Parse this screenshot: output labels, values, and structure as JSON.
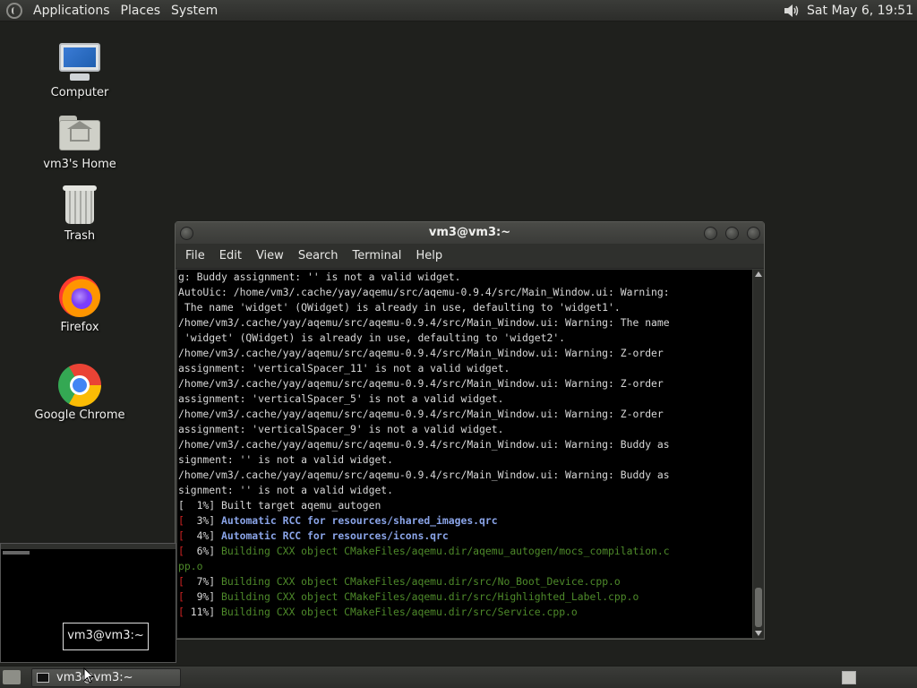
{
  "top_panel": {
    "menus": [
      "Applications",
      "Places",
      "System"
    ],
    "clock": "Sat May  6, 19:51"
  },
  "desktop_icons": [
    {
      "label": "Computer"
    },
    {
      "label": "vm3's Home"
    },
    {
      "label": "Trash"
    },
    {
      "label": "Firefox"
    },
    {
      "label": "Google Chrome"
    }
  ],
  "terminal": {
    "title": "vm3@vm3:~",
    "menu": [
      "File",
      "Edit",
      "View",
      "Search",
      "Terminal",
      "Help"
    ],
    "lines": [
      {
        "text": "g: Buddy assignment: '' is not a valid widget.",
        "color": "white"
      },
      {
        "text": "AutoUic: /home/vm3/.cache/yay/aqemu/src/aqemu-0.9.4/src/Main_Window.ui: Warning:",
        "color": "white"
      },
      {
        "text": " The name 'widget' (QWidget) is already in use, defaulting to 'widget1'.",
        "color": "white"
      },
      {
        "text": "/home/vm3/.cache/yay/aqemu/src/aqemu-0.9.4/src/Main_Window.ui: Warning: The name",
        "color": "white"
      },
      {
        "text": " 'widget' (QWidget) is already in use, defaulting to 'widget2'.",
        "color": "white"
      },
      {
        "text": "/home/vm3/.cache/yay/aqemu/src/aqemu-0.9.4/src/Main_Window.ui: Warning: Z-order",
        "color": "white"
      },
      {
        "text": "assignment: 'verticalSpacer_11' is not a valid widget.",
        "color": "white"
      },
      {
        "text": "/home/vm3/.cache/yay/aqemu/src/aqemu-0.9.4/src/Main_Window.ui: Warning: Z-order",
        "color": "white"
      },
      {
        "text": "assignment: 'verticalSpacer_5' is not a valid widget.",
        "color": "white"
      },
      {
        "text": "/home/vm3/.cache/yay/aqemu/src/aqemu-0.9.4/src/Main_Window.ui: Warning: Z-order",
        "color": "white"
      },
      {
        "text": "assignment: 'verticalSpacer_9' is not a valid widget.",
        "color": "white"
      },
      {
        "text": "/home/vm3/.cache/yay/aqemu/src/aqemu-0.9.4/src/Main_Window.ui: Warning: Buddy as",
        "color": "white"
      },
      {
        "text": "signment: '' is not a valid widget.",
        "color": "white"
      },
      {
        "text": "/home/vm3/.cache/yay/aqemu/src/aqemu-0.9.4/src/Main_Window.ui: Warning: Buddy as",
        "color": "white"
      },
      {
        "text": "signment: '' is not a valid widget.",
        "color": "white"
      },
      {
        "prefix": "[  1%] ",
        "text": "Built target aqemu_autogen",
        "color": "white"
      },
      {
        "prefix": "[  3%] ",
        "text": "Automatic RCC for resources/shared_images.qrc",
        "color": "blue"
      },
      {
        "prefix": "[  4%] ",
        "text": "Automatic RCC for resources/icons.qrc",
        "color": "blue"
      },
      {
        "prefix": "[  6%] ",
        "text": "Building CXX object CMakeFiles/aqemu.dir/aqemu_autogen/mocs_compilation.c",
        "color": "green"
      },
      {
        "text": "pp.o",
        "color": "green"
      },
      {
        "prefix": "[  7%] ",
        "text": "Building CXX object CMakeFiles/aqemu.dir/src/No_Boot_Device.cpp.o",
        "color": "green"
      },
      {
        "prefix": "[  9%] ",
        "text": "Building CXX object CMakeFiles/aqemu.dir/src/Highlighted_Label.cpp.o",
        "color": "green"
      },
      {
        "prefix": "[ 11%] ",
        "text": "Building CXX object CMakeFiles/aqemu.dir/src/Service.cpp.o",
        "color": "green"
      }
    ]
  },
  "preview_tooltip": "vm3@vm3:~",
  "taskbar": {
    "task_label": "vm3@vm3:~"
  }
}
